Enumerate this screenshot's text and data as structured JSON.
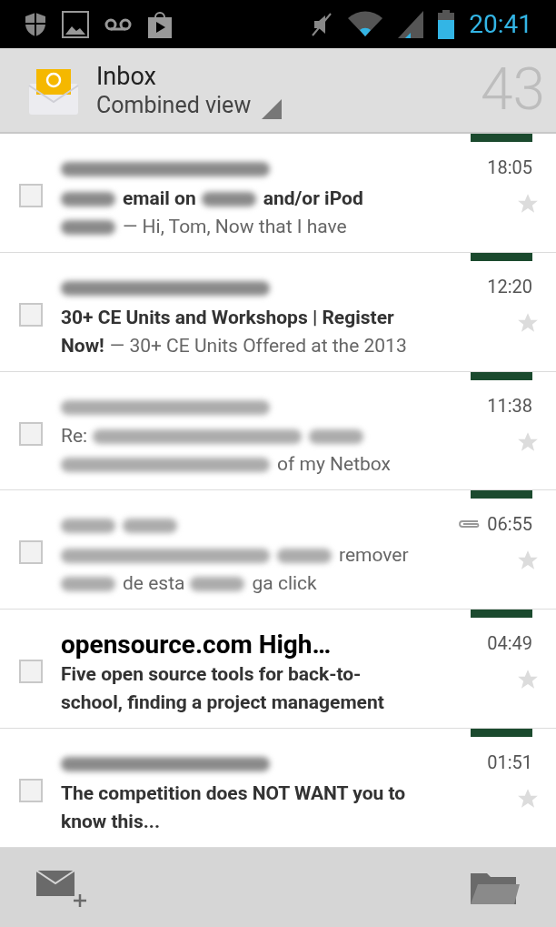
{
  "status_bar": {
    "time": "20:41"
  },
  "header": {
    "title": "Inbox",
    "subtitle": "Combined view",
    "count": "43"
  },
  "messages": [
    {
      "time": "18:05",
      "attachment": false,
      "unread": true,
      "checked": false,
      "starred": false,
      "sender": [
        {
          "kind": "blur"
        }
      ],
      "lines": [
        [
          {
            "kind": "smudge"
          },
          {
            "kind": "subject",
            "text": "email on"
          },
          {
            "kind": "smudge"
          },
          {
            "kind": "subject",
            "text": "and/or iPod"
          }
        ],
        [
          {
            "kind": "smudge"
          },
          {
            "kind": "snippet",
            "text": "— Hi, Tom, Now that I have"
          }
        ]
      ]
    },
    {
      "time": "12:20",
      "attachment": false,
      "unread": true,
      "checked": false,
      "starred": false,
      "sender": [
        {
          "kind": "blur"
        }
      ],
      "lines": [
        [
          {
            "kind": "subject",
            "text": "30+ CE Units and Workshops | Register"
          }
        ],
        [
          {
            "kind": "subject",
            "text": "Now!"
          },
          {
            "kind": "snippet",
            "text": "— 30+ CE Units Offered at the 2013"
          }
        ]
      ]
    },
    {
      "time": "11:38",
      "attachment": false,
      "unread": false,
      "checked": false,
      "starred": false,
      "sender": [
        {
          "kind": "blur"
        }
      ],
      "lines": [
        [
          {
            "kind": "subject",
            "text": "Re:"
          },
          {
            "kind": "blur"
          },
          {
            "kind": "smudge"
          }
        ],
        [
          {
            "kind": "blur"
          },
          {
            "kind": "snippet",
            "text": "of my Netbox"
          }
        ]
      ]
    },
    {
      "time": "06:55",
      "attachment": true,
      "unread": false,
      "checked": false,
      "starred": false,
      "sender": [
        {
          "kind": "smudge"
        },
        {
          "kind": "smudge"
        }
      ],
      "lines": [
        [
          {
            "kind": "blur"
          },
          {
            "kind": "smudge"
          },
          {
            "kind": "snippet",
            "text": "remover"
          }
        ],
        [
          {
            "kind": "smudge"
          },
          {
            "kind": "snippet",
            "text": "de esta"
          },
          {
            "kind": "smudge"
          },
          {
            "kind": "snippet",
            "text": "ga click"
          }
        ]
      ]
    },
    {
      "time": "04:49",
      "attachment": false,
      "unread": true,
      "checked": false,
      "starred": false,
      "sender": [
        {
          "kind": "name",
          "text": "opensource.com High…"
        }
      ],
      "lines": [
        [
          {
            "kind": "subject",
            "text": "Five open source tools for back-to-"
          }
        ],
        [
          {
            "kind": "subject",
            "text": "school, finding a project management"
          }
        ]
      ]
    },
    {
      "time": "01:51",
      "attachment": false,
      "unread": true,
      "checked": false,
      "starred": false,
      "sender": [
        {
          "kind": "blur"
        }
      ],
      "lines": [
        [
          {
            "kind": "subject",
            "text": "The competition does NOT WANT you to"
          }
        ],
        [
          {
            "kind": "subject",
            "text": "know this..."
          }
        ]
      ]
    }
  ]
}
